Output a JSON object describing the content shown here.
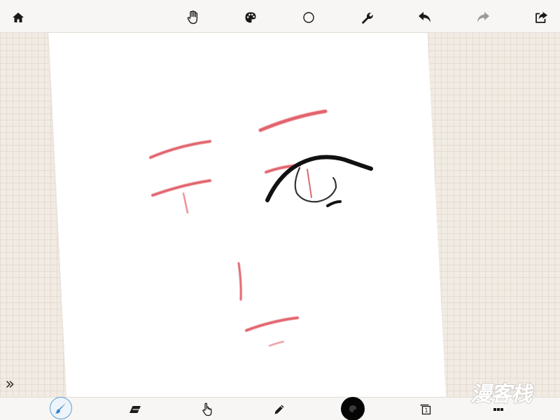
{
  "top_toolbar": {
    "items": [
      {
        "name": "home-icon"
      },
      {
        "name": "hand-icon"
      },
      {
        "name": "palette-icon"
      },
      {
        "name": "circle-icon"
      },
      {
        "name": "wrench-icon"
      },
      {
        "name": "undo-icon"
      },
      {
        "name": "redo-icon"
      },
      {
        "name": "share-icon"
      }
    ]
  },
  "canvas": {
    "background": "#ffffff",
    "sketch_colors": {
      "guide": "#e05a66",
      "ink": "#111111"
    }
  },
  "sidebar_toggle": {
    "icon": "double-chevron-right-icon"
  },
  "bottom_toolbar": {
    "items": [
      {
        "name": "brush-icon",
        "selected": true
      },
      {
        "name": "eraser-icon"
      },
      {
        "name": "finger-smudge-icon"
      },
      {
        "name": "pencil-icon"
      },
      {
        "name": "color-swatch",
        "color": "#000000"
      },
      {
        "name": "layers-icon",
        "layer_count": "1"
      },
      {
        "name": "more-icon"
      }
    ]
  },
  "watermark": {
    "text": "漫客栈"
  },
  "colors": {
    "bar_bg": "#f7f6f4",
    "icon": "#1a1a1a",
    "icon_disabled": "#9a9a9a",
    "accent": "#5b9bd5",
    "surround": "#f1ebe3"
  }
}
